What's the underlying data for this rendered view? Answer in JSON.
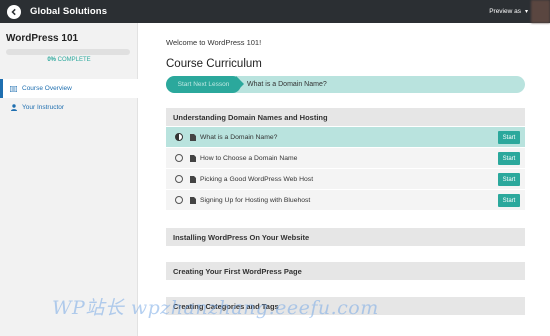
{
  "topbar": {
    "brand": "Global Solutions",
    "preview_label": "Preview as",
    "preview_caret": "▾",
    "background_color": "#2b2f33"
  },
  "sidebar": {
    "course_title": "WordPress 101",
    "progress_value": "0%",
    "progress_suffix": " COMPLETE",
    "progress_fraction": 0,
    "items": [
      {
        "label": "Course Overview",
        "icon": "list-icon",
        "active": true
      },
      {
        "label": "Your Instructor",
        "icon": "user-icon",
        "active": false
      }
    ]
  },
  "main": {
    "welcome": "Welcome to WordPress 101!",
    "curriculum_title": "Course Curriculum",
    "next_lesson_button": "Start Next Lesson",
    "next_lesson_title": "What is a Domain Name?",
    "accent_color": "#2ba89c",
    "sections": [
      {
        "title": "Understanding Domain Names and Hosting",
        "lessons": [
          {
            "title": "What is a Domain Name?",
            "status": "in-progress",
            "action": "Start"
          },
          {
            "title": "How to Choose a Domain Name",
            "status": "not-started",
            "action": "Start"
          },
          {
            "title": "Picking a Good WordPress Web Host",
            "status": "not-started",
            "action": "Start"
          },
          {
            "title": "Signing Up for Hosting with Bluehost",
            "status": "not-started",
            "action": "Start"
          }
        ]
      },
      {
        "title": "Installing WordPress On Your Website"
      },
      {
        "title": "Creating Your First WordPress Page"
      },
      {
        "title": "Creating Categories and Tags"
      }
    ]
  },
  "watermark": "WP站长  wpzhanzhang.eeefu.com"
}
